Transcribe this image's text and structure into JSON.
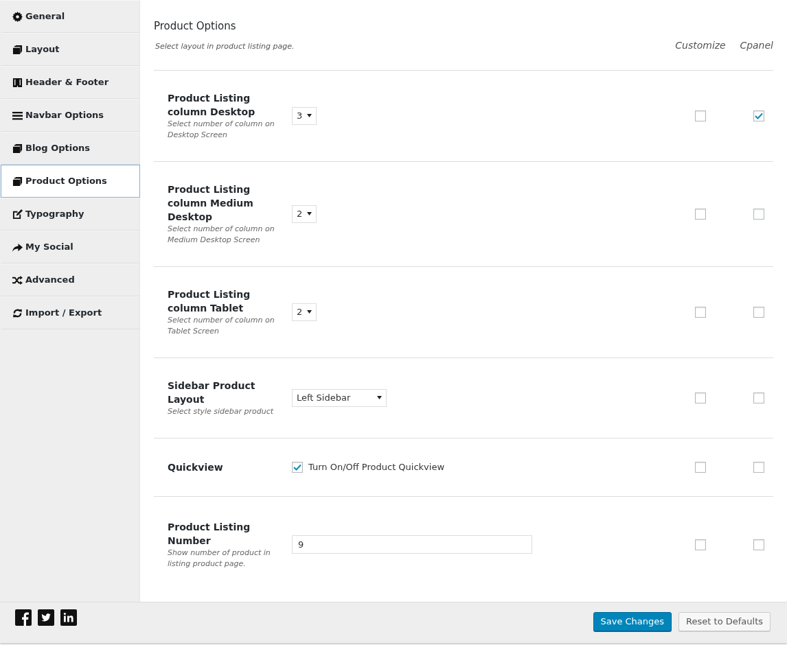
{
  "sidebar": {
    "items": [
      {
        "label": "General",
        "selected": false
      },
      {
        "label": "Layout",
        "selected": false
      },
      {
        "label": "Header & Footer",
        "selected": false
      },
      {
        "label": "Navbar Options",
        "selected": false
      },
      {
        "label": "Blog Options",
        "selected": false
      },
      {
        "label": "Product Options",
        "selected": true
      },
      {
        "label": "Typography",
        "selected": false
      },
      {
        "label": "My Social",
        "selected": false
      },
      {
        "label": "Advanced",
        "selected": false
      },
      {
        "label": "Import / Export",
        "selected": false
      }
    ]
  },
  "section": {
    "title": "Product Options",
    "description": "Select layout in product listing page.",
    "columns": [
      "Customize",
      "Cpanel"
    ]
  },
  "options": [
    {
      "kind": "select",
      "title": "Product Listing column Desktop",
      "subtitle": "Select number of column on Desktop Screen",
      "value": "3",
      "customize": false,
      "cpanel": true
    },
    {
      "kind": "select",
      "title": "Product Listing column Medium Desktop",
      "subtitle": "Select number of column on Medium Desktop Screen",
      "value": "2",
      "customize": false,
      "cpanel": false
    },
    {
      "kind": "select",
      "title": "Product Listing column Tablet",
      "subtitle": "Select number of column on Tablet Screen",
      "value": "2",
      "customize": false,
      "cpanel": false
    },
    {
      "kind": "wide-select",
      "title": "Sidebar Product Layout",
      "subtitle": "Select style sidebar product",
      "value": "Left Sidebar",
      "customize": false,
      "cpanel": false
    },
    {
      "kind": "checkbox",
      "title": "Quickview",
      "label": "Turn On/Off Product Quickview",
      "checked": true,
      "customize": false,
      "cpanel": false
    },
    {
      "kind": "text",
      "title": "Product Listing Number",
      "subtitle": "Show number of product in listing product page.",
      "value": "9",
      "customize": false,
      "cpanel": false
    }
  ],
  "footer": {
    "buttons": [
      {
        "label": "Save Changes",
        "kind": "primary"
      },
      {
        "label": "Reset to Defaults",
        "kind": "secondary"
      }
    ]
  }
}
